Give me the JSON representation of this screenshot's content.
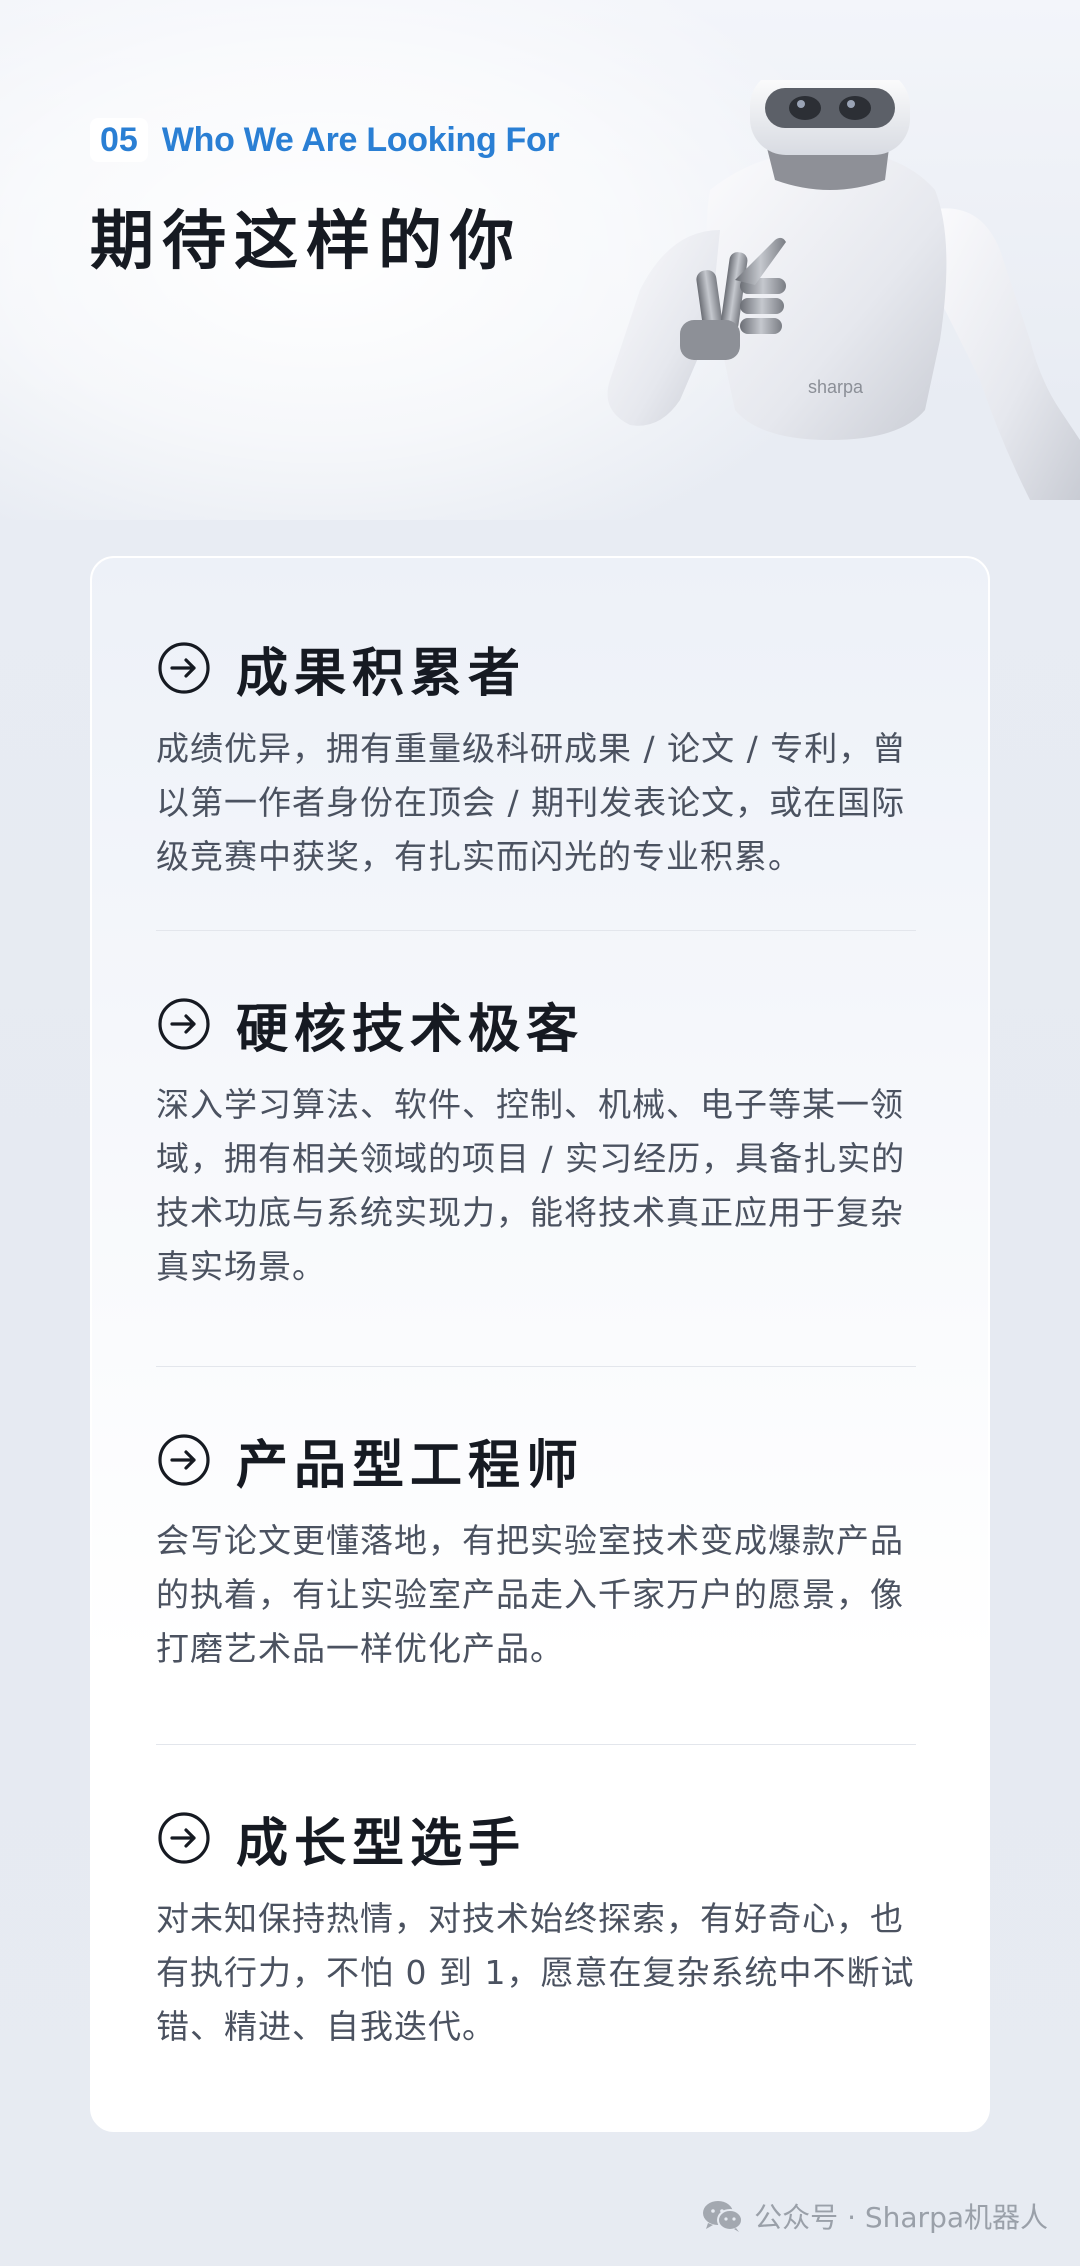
{
  "header": {
    "section_number": "05",
    "section_title_en": "Who We Are Looking For",
    "title": "期待这样的你"
  },
  "robot": {
    "brand_text": "sharpa"
  },
  "items": [
    {
      "title": "成果积累者",
      "body": "成绩优异，拥有重量级科研成果 / 论文 / 专利，曾以第一作者身份在顶会 / 期刊发表论文，或在国际级竞赛中获奖，有扎实而闪光的专业积累。",
      "icon": "arrow-circle-icon"
    },
    {
      "title": "硬核技术极客",
      "body": "深入学习算法、软件、控制、机械、电子等某一领域，拥有相关领域的项目 / 实习经历，具备扎实的技术功底与系统实现力，能将技术真正应用于复杂真实场景。",
      "icon": "arrow-circle-icon"
    },
    {
      "title": "产品型工程师",
      "body": "会写论文更懂落地，有把实验室技术变成爆款产品的执着，有让实验室产品走入千家万户的愿景，像打磨艺术品一样优化产品。",
      "icon": "arrow-circle-icon"
    },
    {
      "title": "成长型选手",
      "body": "对未知保持热情，对技术始终探索，有好奇心，也有执行力，不怕 0 到 1，愿意在复杂系统中不断试错、精进、自我迭代。",
      "icon": "arrow-circle-icon"
    }
  ],
  "footer": {
    "text": "公众号 · Sharpa机器人",
    "icon": "wechat-icon"
  }
}
